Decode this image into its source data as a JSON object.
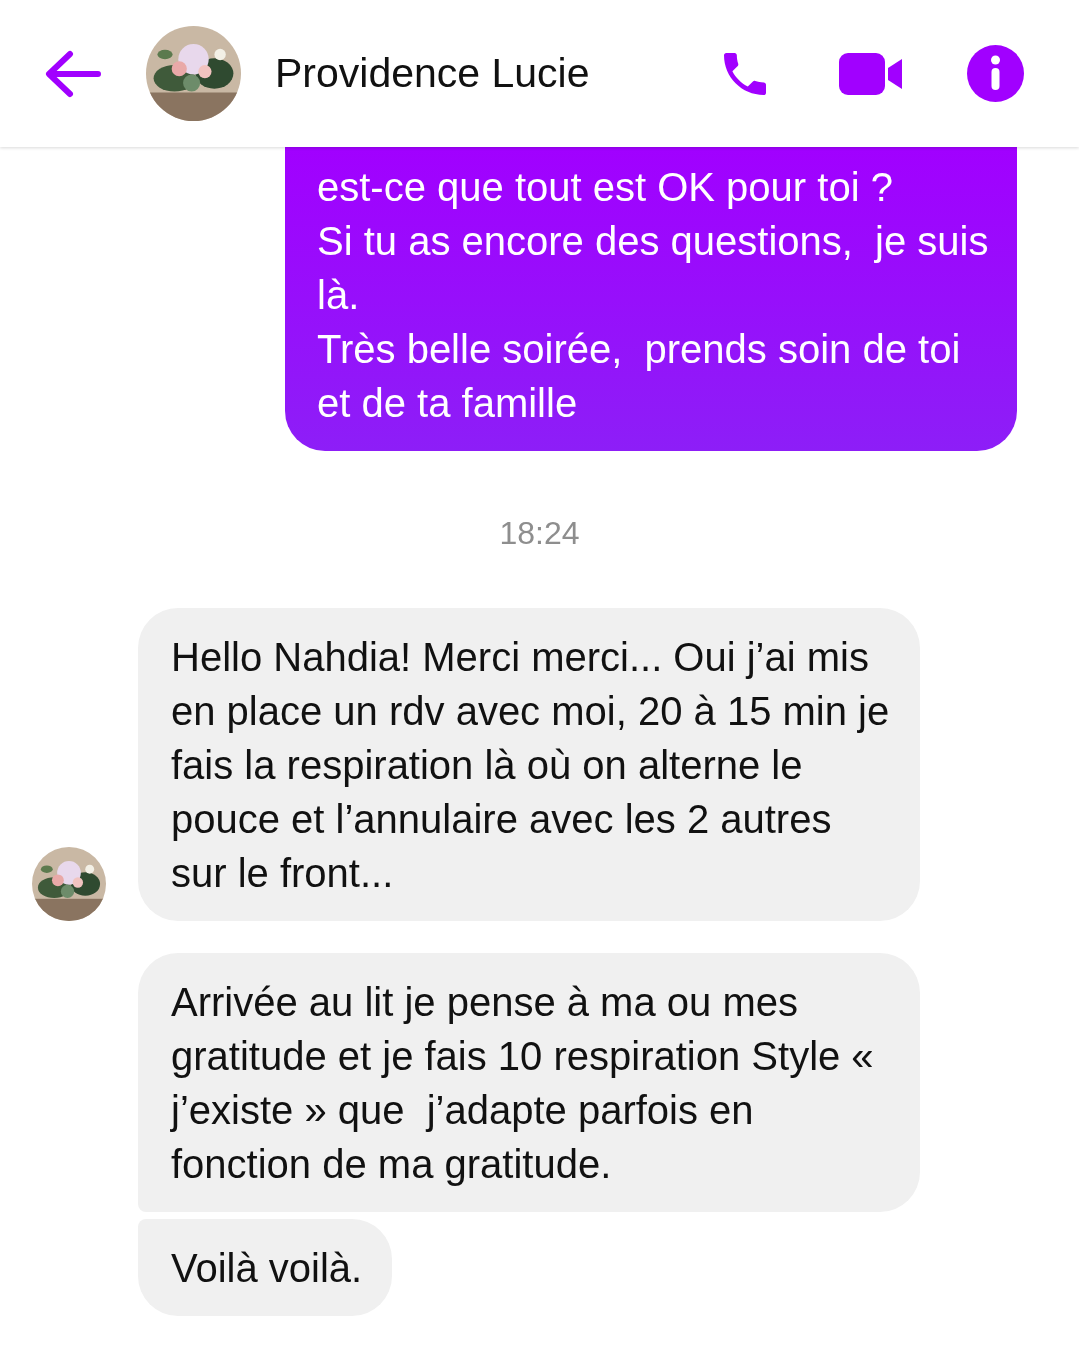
{
  "header": {
    "contact_name": "Providence Lucie"
  },
  "thread": [
    {
      "kind": "outgoing",
      "messages": [
        "est-ce que tout est OK pour toi ?\nSi tu as encore des questions,  je suis là.\nTrès belle soirée,  prends soin de toi et de ta famille"
      ]
    },
    {
      "kind": "time",
      "text": "18:24"
    },
    {
      "kind": "incoming",
      "avatar_shown": true,
      "messages": [
        "Hello Nahdia! Merci merci... Oui j’ai mis en place un rdv avec moi, 20 à 15 min je fais la respiration là où on alterne le pouce et l’annulaire avec les 2 autres sur le front..."
      ]
    },
    {
      "kind": "incoming",
      "avatar_shown": false,
      "messages": [
        "Arrivée au lit je pense à ma ou mes gratitude et je fais 10 respiration Style « j’existe » que  j’adapte parfois en fonction de ma gratitude.",
        "Voilà voilà."
      ]
    }
  ]
}
